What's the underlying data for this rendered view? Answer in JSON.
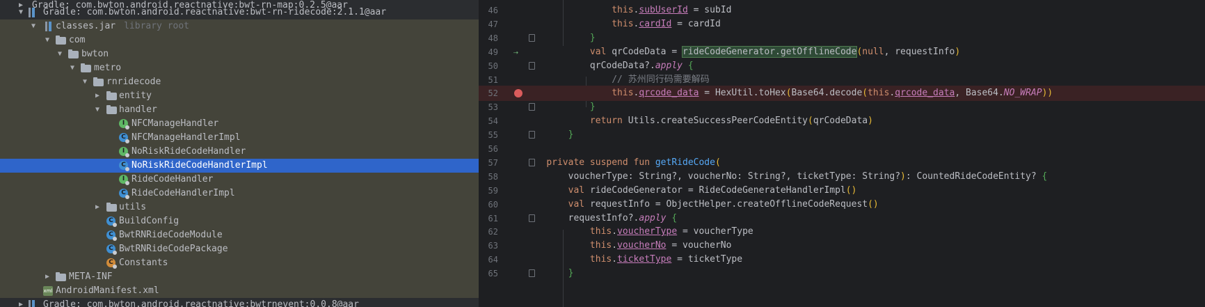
{
  "project_tree": {
    "rows": [
      {
        "label": "Gradle: com.bwton.android.reactnative:bwt-rn-map:0.2.5@aar"
      },
      {
        "label": "Gradle: com.bwton.android.reactnative:bwt-rn-ridecode:2.1.1@aar"
      },
      {
        "label": "classes.jar",
        "hint": "library root"
      },
      {
        "label": "com"
      },
      {
        "label": "bwton"
      },
      {
        "label": "metro"
      },
      {
        "label": "rnridecode"
      },
      {
        "label": "entity"
      },
      {
        "label": "handler"
      },
      {
        "label": "NFCManageHandler",
        "icon_letter": "I"
      },
      {
        "label": "NFCManageHandlerImpl",
        "icon_letter": "C"
      },
      {
        "label": "NoRiskRideCodeHandler",
        "icon_letter": "I"
      },
      {
        "label": "NoRiskRideCodeHandlerImpl",
        "icon_letter": "C"
      },
      {
        "label": "RideCodeHandler",
        "icon_letter": "I"
      },
      {
        "label": "RideCodeHandlerImpl",
        "icon_letter": "C"
      },
      {
        "label": "utils"
      },
      {
        "label": "BuildConfig",
        "icon_letter": "C"
      },
      {
        "label": "BwtRNRideCodeModule",
        "icon_letter": "C"
      },
      {
        "label": "BwtRNRideCodePackage",
        "icon_letter": "C"
      },
      {
        "label": "Constants",
        "icon_letter": "C"
      },
      {
        "label": "META-INF"
      },
      {
        "label": "AndroidManifest.xml",
        "icon_text": "xml"
      },
      {
        "label": "Gradle: com.bwton.android.reactnative:bwtrnevent:0.0.8@aar"
      }
    ],
    "selected_label": "NoRiskRideCodeHandlerImpl"
  },
  "editor": {
    "lines": [
      {
        "n": "46",
        "t": [
          [
            "",
            "                "
          ],
          [
            "kw",
            "this"
          ],
          [
            "",
            "."
          ],
          [
            "prop",
            "subUserId"
          ],
          [
            "",
            " = subId"
          ]
        ]
      },
      {
        "n": "47",
        "t": [
          [
            "",
            "                "
          ],
          [
            "kw",
            "this"
          ],
          [
            "",
            "."
          ],
          [
            "prop",
            "cardId"
          ],
          [
            "",
            " = cardId"
          ]
        ]
      },
      {
        "n": "48",
        "t": [
          [
            "",
            "            "
          ],
          [
            "brg",
            "}"
          ]
        ]
      },
      {
        "n": "49",
        "t": [
          [
            "",
            "            "
          ],
          [
            "kw",
            "val "
          ],
          [
            "",
            "qrCodeData = "
          ],
          [
            "hl",
            "rideCodeGenerator.getOfflineCode"
          ],
          [
            "br",
            "("
          ],
          [
            "kw",
            "null"
          ],
          [
            "",
            ", requestInfo"
          ],
          [
            "br",
            ")"
          ]
        ]
      },
      {
        "n": "50",
        "t": [
          [
            "",
            "            qrCodeData?."
          ],
          [
            "ext",
            "apply"
          ],
          [
            "",
            " "
          ],
          [
            "brg",
            "{"
          ]
        ]
      },
      {
        "n": "51",
        "t": [
          [
            "",
            "                "
          ],
          [
            "cmt",
            "// 苏州同行码需要解码"
          ]
        ]
      },
      {
        "n": "52",
        "t": [
          [
            "",
            "                "
          ],
          [
            "kw",
            "this"
          ],
          [
            "",
            "."
          ],
          [
            "prop",
            "qrcode_data"
          ],
          [
            "",
            " = HexUtil.toHex"
          ],
          [
            "br",
            "("
          ],
          [
            "",
            "Base64.decode"
          ],
          [
            "br",
            "("
          ],
          [
            "kw",
            "this"
          ],
          [
            "",
            "."
          ],
          [
            "prop",
            "qrcode_data"
          ],
          [
            "",
            ", Base64."
          ],
          [
            "const",
            "NO_WRAP"
          ],
          [
            "br",
            "))"
          ]
        ]
      },
      {
        "n": "53",
        "t": [
          [
            "",
            "            "
          ],
          [
            "brg",
            "}"
          ]
        ]
      },
      {
        "n": "54",
        "t": [
          [
            "",
            "            "
          ],
          [
            "kw",
            "return "
          ],
          [
            "",
            "Utils.createSuccessPeerCodeEntity"
          ],
          [
            "br",
            "("
          ],
          [
            "",
            "qrCodeData"
          ],
          [
            "br",
            ")"
          ]
        ]
      },
      {
        "n": "55",
        "t": [
          [
            "",
            "        "
          ],
          [
            "brg",
            "}"
          ]
        ]
      },
      {
        "n": "56",
        "t": [
          [
            "",
            ""
          ]
        ]
      },
      {
        "n": "57",
        "t": [
          [
            "",
            "    "
          ],
          [
            "kw",
            "private suspend fun "
          ],
          [
            "fn",
            "getRideCode"
          ],
          [
            "br",
            "("
          ]
        ]
      },
      {
        "n": "58",
        "t": [
          [
            "",
            "        voucherType: String?, voucherNo: String?, ticketType: String?"
          ],
          [
            "br",
            ")"
          ],
          [
            "",
            ": CountedRideCodeEntity? "
          ],
          [
            "brg",
            "{"
          ]
        ]
      },
      {
        "n": "59",
        "t": [
          [
            "",
            "        "
          ],
          [
            "kw",
            "val "
          ],
          [
            "",
            "rideCodeGenerator = RideCodeGenerateHandlerImpl"
          ],
          [
            "br",
            "()"
          ]
        ]
      },
      {
        "n": "60",
        "t": [
          [
            "",
            "        "
          ],
          [
            "kw",
            "val "
          ],
          [
            "",
            "requestInfo = ObjectHelper.createOfflineCodeRequest"
          ],
          [
            "br",
            "()"
          ]
        ]
      },
      {
        "n": "61",
        "t": [
          [
            "",
            "        requestInfo?."
          ],
          [
            "ext",
            "apply"
          ],
          [
            "",
            " "
          ],
          [
            "brg",
            "{"
          ]
        ]
      },
      {
        "n": "62",
        "t": [
          [
            "",
            "            "
          ],
          [
            "kw",
            "this"
          ],
          [
            "",
            "."
          ],
          [
            "prop",
            "voucherType"
          ],
          [
            "",
            " = voucherType"
          ]
        ]
      },
      {
        "n": "63",
        "t": [
          [
            "",
            "            "
          ],
          [
            "kw",
            "this"
          ],
          [
            "",
            "."
          ],
          [
            "prop",
            "voucherNo"
          ],
          [
            "",
            " = voucherNo"
          ]
        ]
      },
      {
        "n": "64",
        "t": [
          [
            "",
            "            "
          ],
          [
            "kw",
            "this"
          ],
          [
            "",
            "."
          ],
          [
            "prop",
            "ticketType"
          ],
          [
            "",
            " = ticketType"
          ]
        ]
      },
      {
        "n": "65",
        "t": [
          [
            "",
            "        "
          ],
          [
            "brg",
            "}"
          ]
        ]
      }
    ],
    "breakpoint_line": "52",
    "execution_marker_line": "49"
  },
  "colors": {
    "tree_bg": "#2b2d30",
    "tree_library_bg": "#44443a",
    "selection": "#2f65ca",
    "editor_bg": "#1e1f22",
    "keyword": "#cf8e6d",
    "property": "#c77dbb",
    "function": "#56a8f5",
    "comment": "#7a7e85",
    "breakpoint": "#db5c5c"
  }
}
